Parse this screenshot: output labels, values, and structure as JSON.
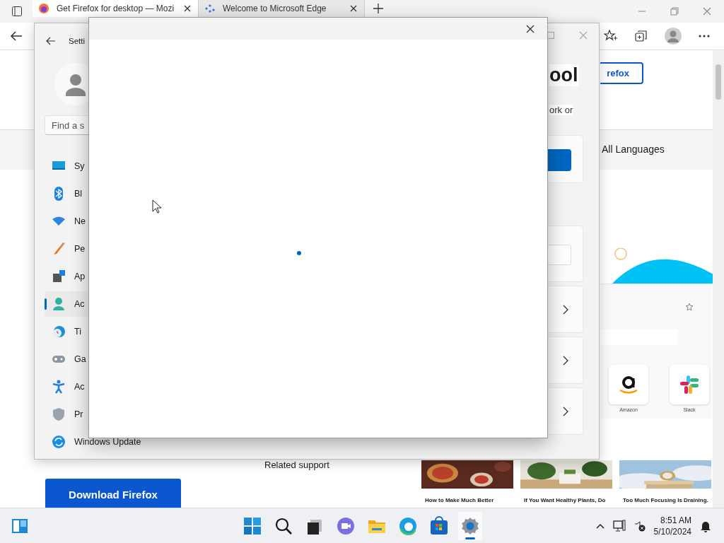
{
  "browser": {
    "tabs": [
      {
        "title": "Get Firefox for desktop — Mozi",
        "selected": true
      },
      {
        "title": "Welcome to Microsoft Edge",
        "selected": false
      }
    ],
    "page": {
      "heading": "ool",
      "text": "ork or",
      "outline_button": "refox",
      "language": "All Languages",
      "download_button": "Download Firefox",
      "related": "Related support",
      "shortcuts": [
        {
          "label": "Amazon"
        },
        {
          "label": "Slack"
        }
      ],
      "articles": [
        {
          "title": "How to Make Much Better"
        },
        {
          "title": "If You Want Healthy Plants, Do"
        },
        {
          "title": "Too Much Focusing Is Draining."
        }
      ]
    }
  },
  "settings": {
    "title": "Setti",
    "search_placeholder": "Find a s",
    "nav": [
      {
        "label": "Sy",
        "selected": false
      },
      {
        "label": "Bl",
        "selected": false
      },
      {
        "label": "Ne",
        "selected": false
      },
      {
        "label": "Pe",
        "selected": false
      },
      {
        "label": "Ap",
        "selected": false
      },
      {
        "label": "Ac",
        "selected": true
      },
      {
        "label": "Ti",
        "selected": false
      },
      {
        "label": "Ga",
        "selected": false
      },
      {
        "label": "Ac",
        "selected": false
      },
      {
        "label": "Pr",
        "selected": false
      },
      {
        "label": "Windows Update",
        "selected": false
      }
    ]
  },
  "taskbar": {
    "apps": [
      {
        "kind": "start",
        "selected": false
      },
      {
        "kind": "search",
        "selected": false
      },
      {
        "kind": "taskview",
        "selected": false
      },
      {
        "kind": "chat",
        "selected": false
      },
      {
        "kind": "files",
        "selected": false
      },
      {
        "kind": "browser",
        "selected": false
      },
      {
        "kind": "store",
        "selected": false
      },
      {
        "kind": "settings",
        "selected": true
      }
    ],
    "time": "8:51 AM",
    "date": "5/10/2024"
  }
}
